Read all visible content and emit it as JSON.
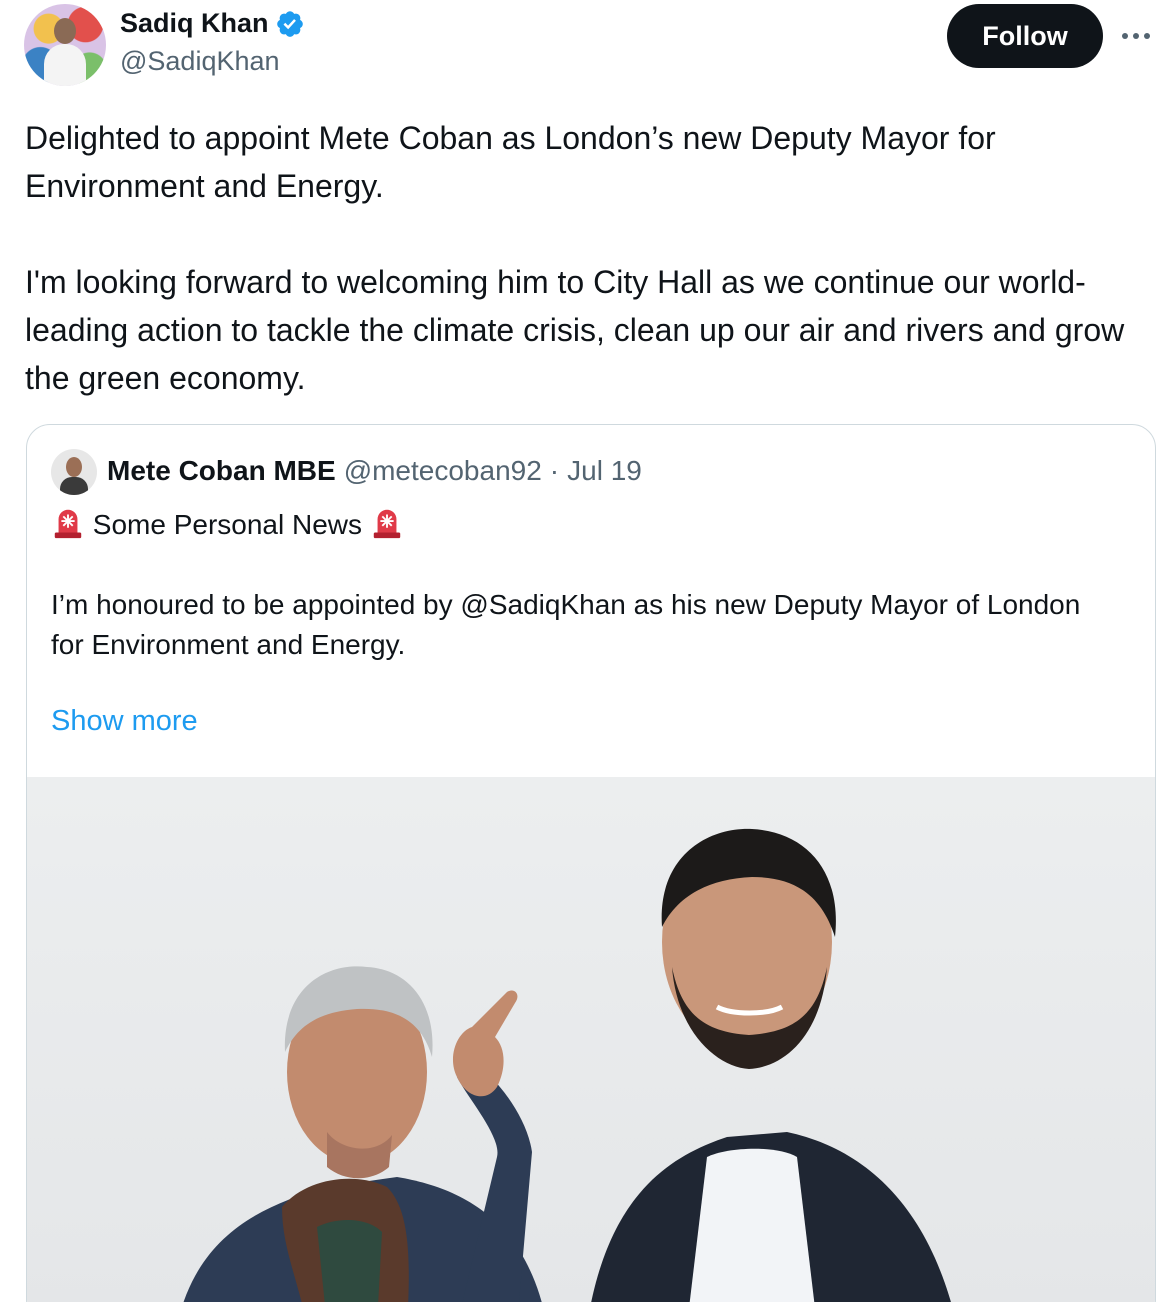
{
  "author": {
    "display_name": "Sadiq Khan",
    "handle": "@SadiqKhan",
    "avatar": "profile-photo",
    "verified_icon": "verified-badge-icon",
    "verified_color": "#1d9bf0"
  },
  "actions": {
    "follow_label": "Follow",
    "more_icon": "more-horizontal-icon"
  },
  "tweet": {
    "paragraphs": [
      "Delighted to appoint Mete Coban as London’s new Deputy Mayor for Environment and Energy.",
      "I'm looking forward to welcoming him to City Hall as we continue our world-leading action to tackle the climate crisis, clean up our air and rivers and grow the green economy."
    ]
  },
  "quoted": {
    "display_name": "Mete Coban MBE",
    "handle": "@metecoban92",
    "separator": "·",
    "date": "Jul 19",
    "headline": "Some Personal News",
    "headline_icon": "rotating-light-emoji",
    "body": "I’m honoured to be appointed by @SadiqKhan as his new Deputy Mayor of London for Environment and Energy.",
    "show_more_label": "Show more",
    "image": "photo of two men standing outdoors, one pointing",
    "link_color": "#1d9bf0"
  },
  "colors": {
    "text_primary": "#0f1419",
    "text_secondary": "#536471",
    "border": "#cfd9de",
    "follow_bg": "#0f1419"
  }
}
